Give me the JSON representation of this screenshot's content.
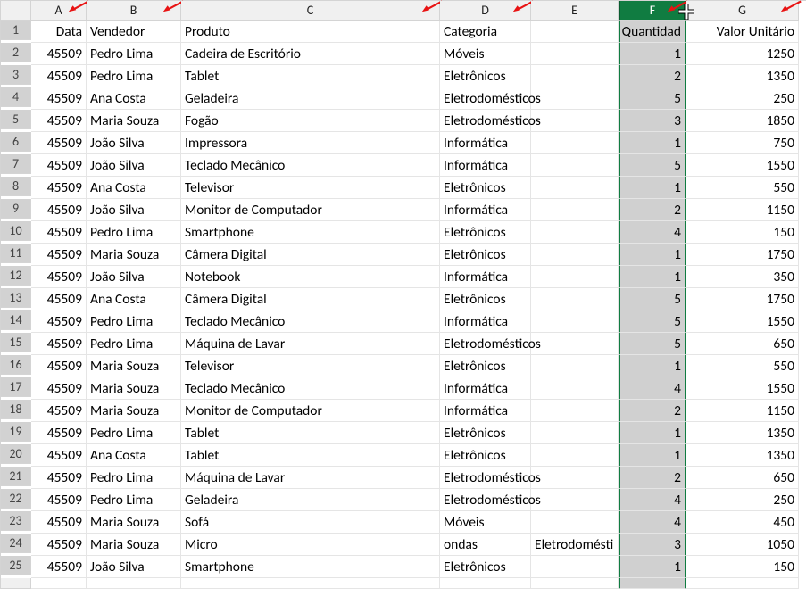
{
  "columns": [
    "A",
    "B",
    "C",
    "D",
    "E",
    "F",
    "G"
  ],
  "headers": {
    "A": "Data",
    "B": "Vendedor",
    "C": "Produto",
    "D": "Categoria",
    "E": "",
    "F": "Quantidade",
    "G": "Valor Unitário"
  },
  "rows": [
    {
      "n": 1,
      "A": "Data",
      "B": "Vendedor",
      "C": "Produto",
      "D": "Categoria",
      "E": "",
      "F": "Quantidade",
      "G": "Valor Unitário"
    },
    {
      "n": 2,
      "A": "45509",
      "B": "Pedro Lima",
      "C": "Cadeira de Escritório",
      "D": "Móveis",
      "E": "",
      "F": "1",
      "G": "1250"
    },
    {
      "n": 3,
      "A": "45509",
      "B": "Pedro Lima",
      "C": "Tablet",
      "D": "Eletrônicos",
      "E": "",
      "F": "2",
      "G": "1350"
    },
    {
      "n": 4,
      "A": "45509",
      "B": "Ana Costa",
      "C": "Geladeira",
      "D": "Eletrodomésticos",
      "E": "",
      "F": "5",
      "G": "250"
    },
    {
      "n": 5,
      "A": "45509",
      "B": "Maria Souza",
      "C": "Fogão",
      "D": "Eletrodomésticos",
      "E": "",
      "F": "3",
      "G": "1850"
    },
    {
      "n": 6,
      "A": "45509",
      "B": "João Silva",
      "C": "Impressora",
      "D": "Informática",
      "E": "",
      "F": "1",
      "G": "750"
    },
    {
      "n": 7,
      "A": "45509",
      "B": "João Silva",
      "C": "Teclado Mecânico",
      "D": "Informática",
      "E": "",
      "F": "5",
      "G": "1550"
    },
    {
      "n": 8,
      "A": "45509",
      "B": "Ana Costa",
      "C": "Televisor",
      "D": "Eletrônicos",
      "E": "",
      "F": "1",
      "G": "550"
    },
    {
      "n": 9,
      "A": "45509",
      "B": "João Silva",
      "C": "Monitor de Computador",
      "D": "Informática",
      "E": "",
      "F": "2",
      "G": "1150"
    },
    {
      "n": 10,
      "A": "45509",
      "B": "Pedro Lima",
      "C": "Smartphone",
      "D": "Eletrônicos",
      "E": "",
      "F": "4",
      "G": "150"
    },
    {
      "n": 11,
      "A": "45509",
      "B": "Maria Souza",
      "C": "Câmera Digital",
      "D": "Eletrônicos",
      "E": "",
      "F": "1",
      "G": "1750"
    },
    {
      "n": 12,
      "A": "45509",
      "B": "João Silva",
      "C": "Notebook",
      "D": "Informática",
      "E": "",
      "F": "1",
      "G": "350"
    },
    {
      "n": 13,
      "A": "45509",
      "B": "Ana Costa",
      "C": "Câmera Digital",
      "D": "Eletrônicos",
      "E": "",
      "F": "5",
      "G": "1750"
    },
    {
      "n": 14,
      "A": "45509",
      "B": "Pedro Lima",
      "C": "Teclado Mecânico",
      "D": "Informática",
      "E": "",
      "F": "5",
      "G": "1550"
    },
    {
      "n": 15,
      "A": "45509",
      "B": "Pedro Lima",
      "C": "Máquina de Lavar",
      "D": "Eletrodomésticos",
      "E": "",
      "F": "5",
      "G": "650"
    },
    {
      "n": 16,
      "A": "45509",
      "B": "Maria Souza",
      "C": "Televisor",
      "D": "Eletrônicos",
      "E": "",
      "F": "1",
      "G": "550"
    },
    {
      "n": 17,
      "A": "45509",
      "B": "Maria Souza",
      "C": "Teclado Mecânico",
      "D": "Informática",
      "E": "",
      "F": "4",
      "G": "1550"
    },
    {
      "n": 18,
      "A": "45509",
      "B": "Maria Souza",
      "C": "Monitor de Computador",
      "D": "Informática",
      "E": "",
      "F": "2",
      "G": "1150"
    },
    {
      "n": 19,
      "A": "45509",
      "B": "Pedro Lima",
      "C": "Tablet",
      "D": "Eletrônicos",
      "E": "",
      "F": "1",
      "G": "1350"
    },
    {
      "n": 20,
      "A": "45509",
      "B": "Ana Costa",
      "C": "Tablet",
      "D": "Eletrônicos",
      "E": "",
      "F": "1",
      "G": "1350"
    },
    {
      "n": 21,
      "A": "45509",
      "B": "Pedro Lima",
      "C": "Máquina de Lavar",
      "D": "Eletrodomésticos",
      "E": "",
      "F": "2",
      "G": "650"
    },
    {
      "n": 22,
      "A": "45509",
      "B": "Pedro Lima",
      "C": "Geladeira",
      "D": "Eletrodomésticos",
      "E": "",
      "F": "4",
      "G": "250"
    },
    {
      "n": 23,
      "A": "45509",
      "B": "Maria Souza",
      "C": "Sofá",
      "D": "Móveis",
      "E": "",
      "F": "4",
      "G": "450"
    },
    {
      "n": 24,
      "A": "45509",
      "B": "Maria Souza",
      "C": "Micro",
      "D": "ondas",
      "E": "Eletrodomésti",
      "F": "3",
      "G": "1050"
    },
    {
      "n": 25,
      "A": "45509",
      "B": "João Silva",
      "C": "Smartphone",
      "D": "Eletrônicos",
      "E": "",
      "F": "1",
      "G": "150"
    }
  ],
  "selectedColumn": "F",
  "arrowPositions": [
    "A",
    "B",
    "C",
    "D",
    "F",
    "G"
  ]
}
